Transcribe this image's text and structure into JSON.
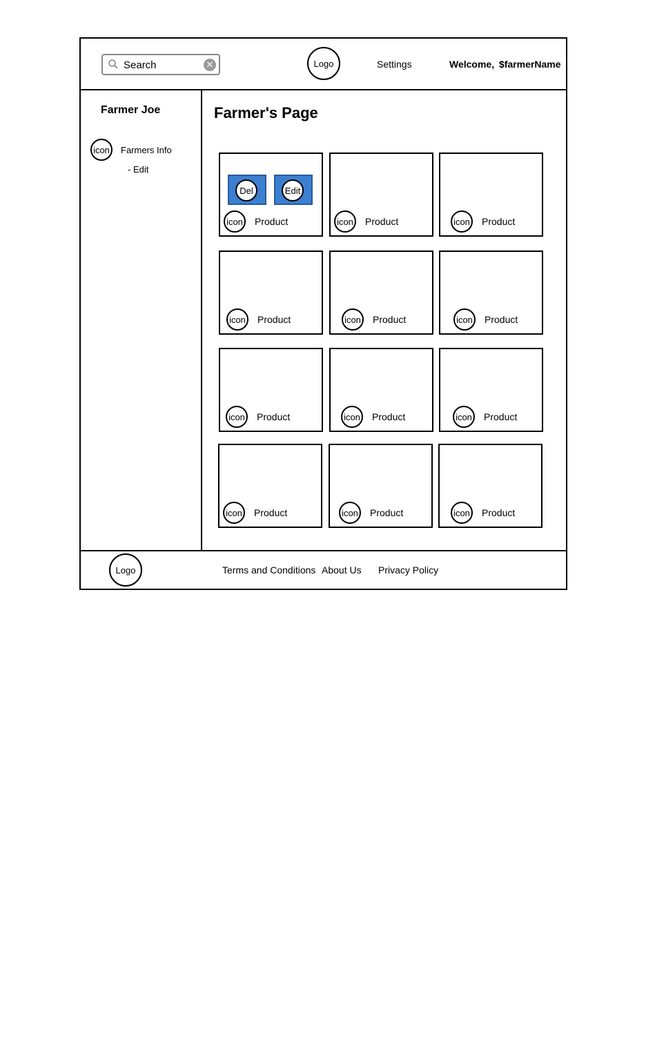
{
  "header": {
    "search_placeholder": "Search",
    "logo_label": "Logo",
    "settings_label": "Settings",
    "welcome_label": "Welcome,",
    "farmer_name": "$farmerName"
  },
  "sidebar": {
    "farmer_name": "Farmer Joe",
    "items": [
      {
        "icon_label": "icon",
        "label": "Farmers Info"
      },
      {
        "label": "- Edit"
      }
    ]
  },
  "main": {
    "title": "Farmer's Page",
    "del_label": "Del",
    "edit_label": "Edit",
    "products": [
      {
        "icon_label": "icon",
        "label": "Product"
      },
      {
        "icon_label": "icon",
        "label": "Product"
      },
      {
        "icon_label": "icon",
        "label": "Product"
      },
      {
        "icon_label": "icon",
        "label": "Product"
      },
      {
        "icon_label": "icon",
        "label": "Product"
      },
      {
        "icon_label": "icon",
        "label": "Product"
      },
      {
        "icon_label": "icon",
        "label": "Product"
      },
      {
        "icon_label": "icon",
        "label": "Product"
      },
      {
        "icon_label": "icon",
        "label": "Product"
      },
      {
        "icon_label": "icon",
        "label": "Product"
      },
      {
        "icon_label": "icon",
        "label": "Product"
      },
      {
        "icon_label": "icon",
        "label": "Product"
      }
    ]
  },
  "footer": {
    "logo_label": "Logo",
    "links": [
      "Terms and Conditions",
      "About Us",
      "Privacy Policy"
    ]
  },
  "colors": {
    "button_fill": "#3c7fd0",
    "border": "#000000"
  }
}
